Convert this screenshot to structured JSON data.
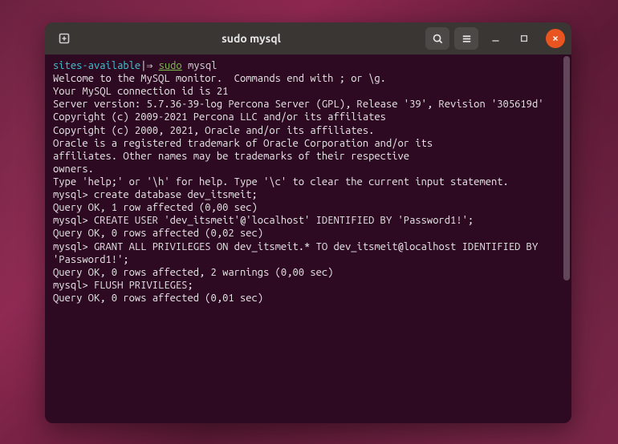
{
  "titlebar": {
    "title": "sudo mysql"
  },
  "prompt": {
    "path": "sites-available",
    "separator": "|",
    "arrow": "⇒",
    "sudo": "sudo",
    "cmd": "mysql"
  },
  "terminal": {
    "lines": [
      "Welcome to the MySQL monitor.  Commands end with ; or \\g.",
      "Your MySQL connection id is 21",
      "Server version: 5.7.36-39-log Percona Server (GPL), Release '39', Revision '305619d'",
      "",
      "Copyright (c) 2009-2021 Percona LLC and/or its affiliates",
      "Copyright (c) 2000, 2021, Oracle and/or its affiliates.",
      "",
      "Oracle is a registered trademark of Oracle Corporation and/or its",
      "affiliates. Other names may be trademarks of their respective",
      "owners.",
      "",
      "Type 'help;' or '\\h' for help. Type '\\c' to clear the current input statement.",
      "",
      "mysql> create database dev_itsmeit;",
      "Query OK, 1 row affected (0,00 sec)",
      "",
      "mysql> CREATE USER 'dev_itsmeit'@'localhost' IDENTIFIED BY 'Password1!';",
      "Query OK, 0 rows affected (0,02 sec)",
      "",
      "mysql> GRANT ALL PRIVILEGES ON dev_itsmeit.* TO dev_itsmeit@localhost IDENTIFIED BY 'Password1!';",
      "Query OK, 0 rows affected, 2 warnings (0,00 sec)",
      "",
      "mysql> FLUSH PRIVILEGES;",
      "Query OK, 0 rows affected (0,01 sec)"
    ]
  }
}
